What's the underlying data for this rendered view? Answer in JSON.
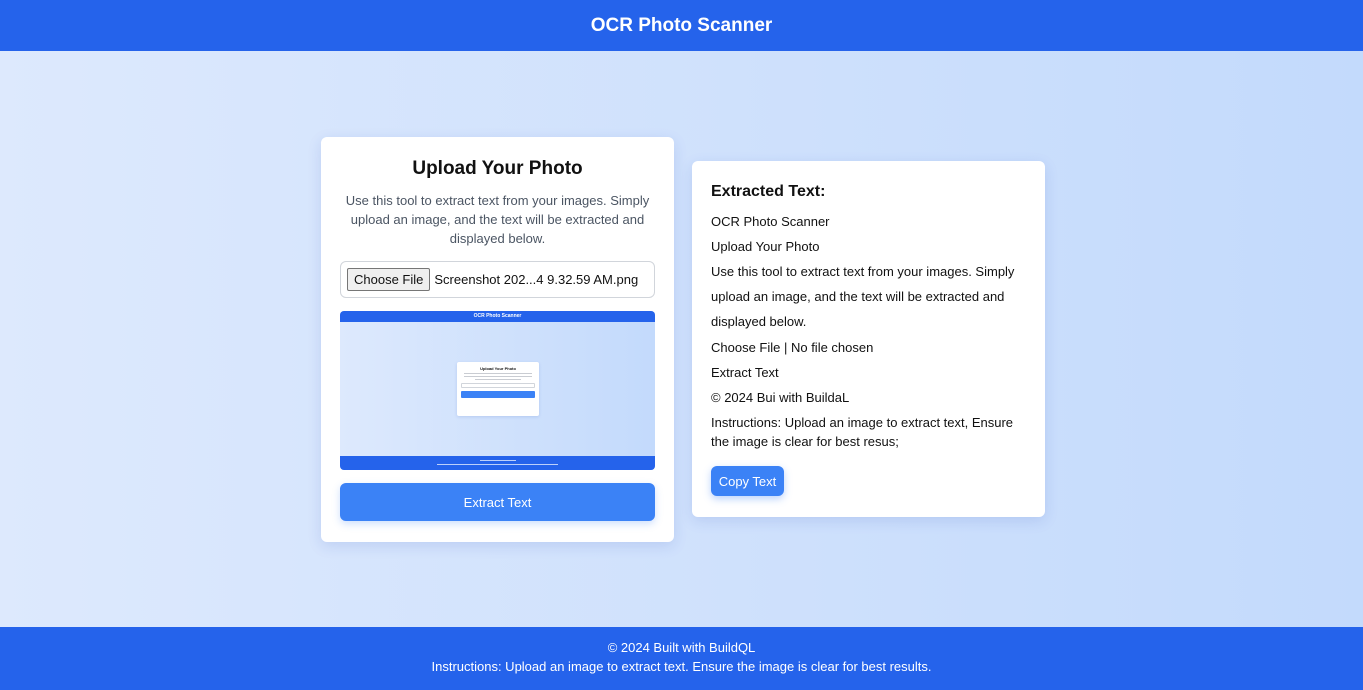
{
  "header": {
    "title": "OCR Photo Scanner"
  },
  "upload": {
    "title": "Upload Your Photo",
    "description": "Use this tool to extract text from your images. Simply upload an image, and the text will be extracted and displayed below.",
    "choose_file_label": "Choose File",
    "file_name": "Screenshot 202...4 9.32.59 AM.png",
    "preview": {
      "header_title": "OCR Photo Scanner",
      "card_title": "Upload Your Photo"
    },
    "extract_button_label": "Extract Text"
  },
  "result": {
    "title": "Extracted Text:",
    "lines": [
      "OCR Photo Scanner",
      "Upload Your Photo",
      "Use this tool to extract text from your images. Simply upload an image, and the text will be extracted and displayed below.",
      "Choose File | No file chosen",
      "Extract Text",
      "© 2024 Bui with BuildaL",
      "Instructions: Upload an image to extract text, Ensure the image is clear for best resus;"
    ],
    "copy_button_label": "Copy Text"
  },
  "footer": {
    "copyright": "© 2024 Built with BuildQL",
    "instructions": "Instructions: Upload an image to extract text. Ensure the image is clear for best results."
  },
  "colors": {
    "brand_blue": "#2563eb",
    "button_blue": "#3b82f6",
    "background_left": "#dde9fd",
    "background_right": "#c3dafc"
  },
  "icons": []
}
